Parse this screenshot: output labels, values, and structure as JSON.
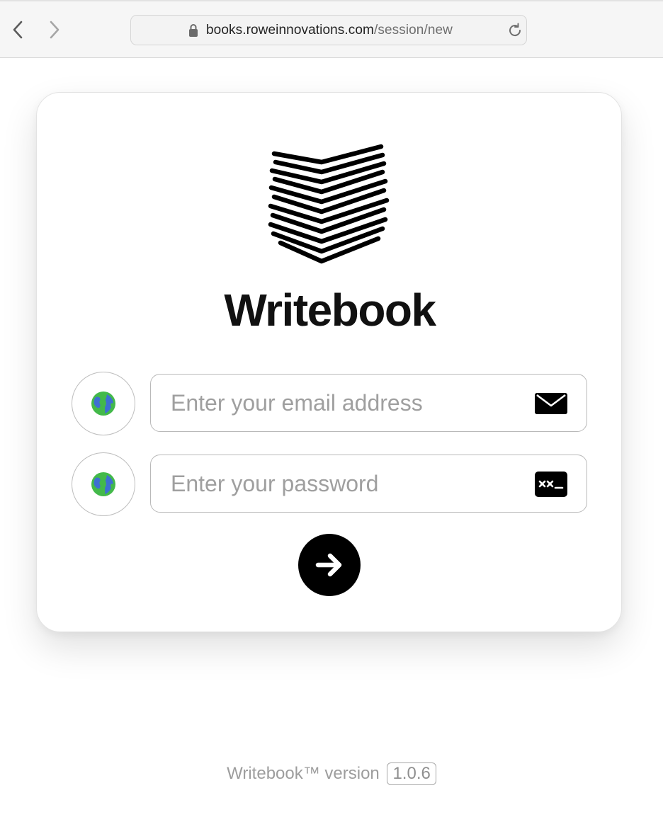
{
  "browser": {
    "url_host": "books.roweinnovations.com",
    "url_path": "/session/new"
  },
  "login": {
    "brand_name": "Writebook",
    "email_placeholder": "Enter your email address",
    "password_placeholder": "Enter your password",
    "icons": {
      "language_button": "globe-icon",
      "email_field": "envelope-icon",
      "password_field": "password-icon",
      "submit": "arrow-right-icon"
    }
  },
  "footer": {
    "version_label": "Writebook™ version",
    "version_number": "1.0.6"
  },
  "colors": {
    "primary_black": "#000000",
    "globe_green": "#43b94a",
    "globe_blue": "#3e6fd2",
    "placeholder_gray": "#9f9f9f"
  }
}
